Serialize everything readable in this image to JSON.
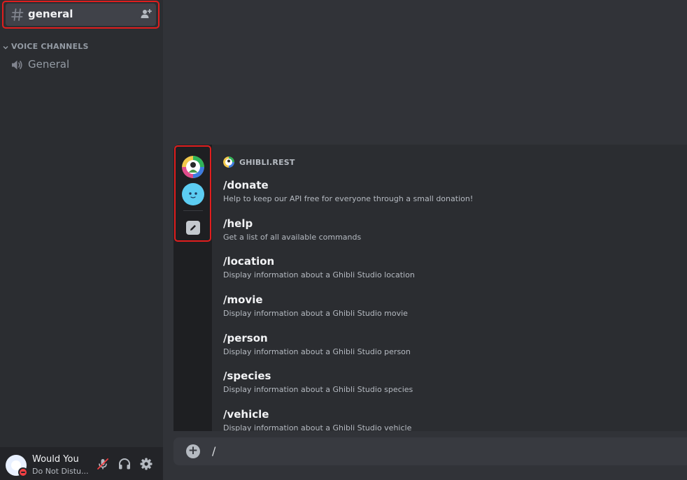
{
  "sidebar": {
    "active_channel": {
      "name": "general",
      "icon": "hash-icon"
    },
    "voice_category": "VOICE CHANNELS",
    "voice_channels": [
      {
        "name": "General",
        "icon": "speaker-icon"
      }
    ]
  },
  "user_panel": {
    "name": "Would You",
    "status": "Do Not Distu...",
    "controls": [
      "mute-icon",
      "headphones-icon",
      "gear-icon"
    ]
  },
  "autocomplete": {
    "section_title": "GHIBLI.REST",
    "commands": [
      {
        "name": "/donate",
        "description": "Help to keep our API free for everyone through a small donation!"
      },
      {
        "name": "/help",
        "description": "Get a list of all available commands"
      },
      {
        "name": "/location",
        "description": "Display information about a Ghibli Studio location"
      },
      {
        "name": "/movie",
        "description": "Display information about a Ghibli Studio movie"
      },
      {
        "name": "/person",
        "description": "Display information about a Ghibli Studio person"
      },
      {
        "name": "/species",
        "description": "Display information about a Ghibli Studio species"
      },
      {
        "name": "/vehicle",
        "description": "Display information about a Ghibli Studio vehicle"
      }
    ]
  },
  "composer": {
    "value": "/"
  },
  "colors": {
    "highlight": "#e01e1e",
    "dnd": "#f23f43",
    "app_icon_blue": "#5ccdf2"
  }
}
